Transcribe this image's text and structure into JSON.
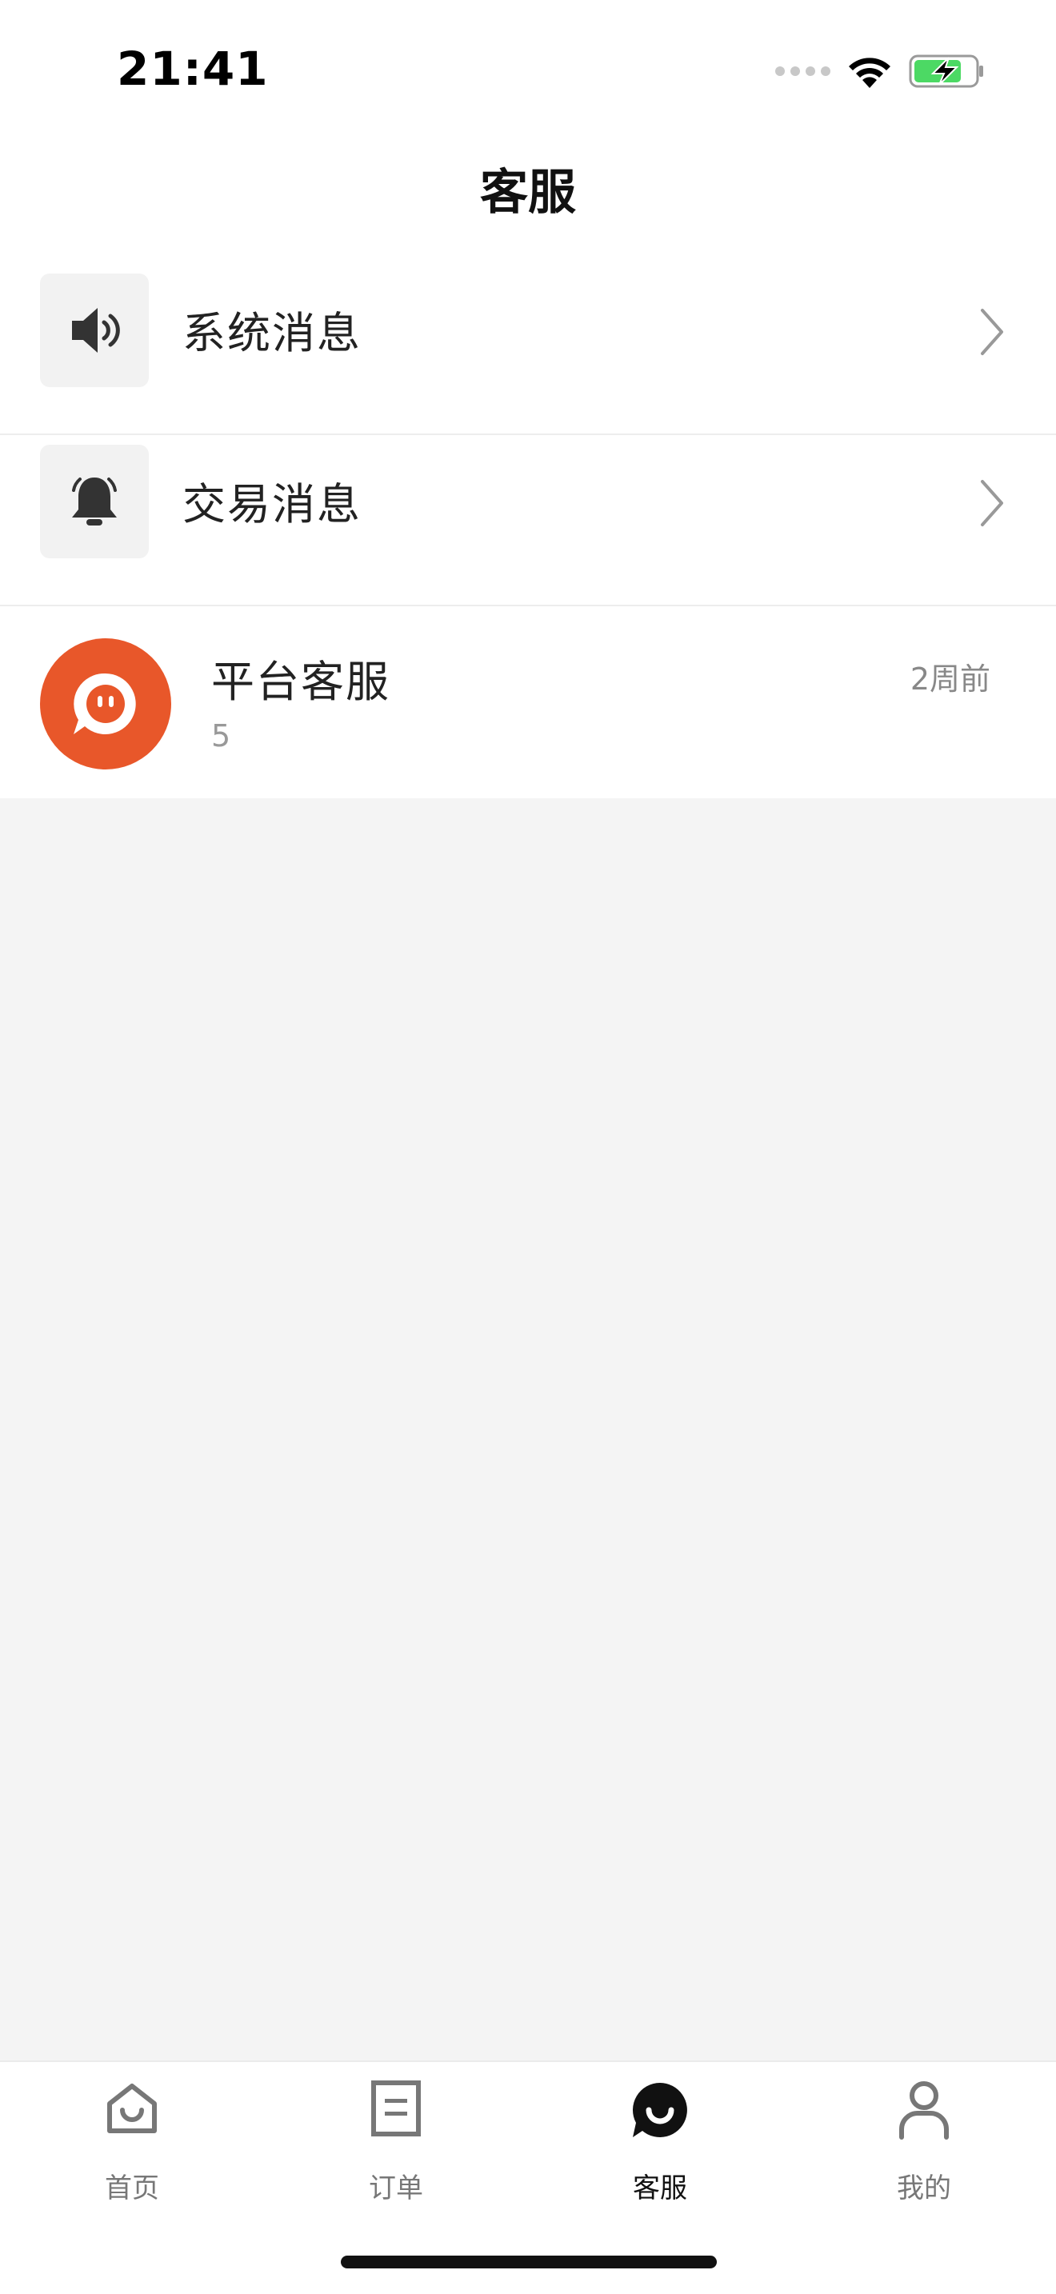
{
  "status_bar": {
    "time": "21:41"
  },
  "nav": {
    "title": "客服"
  },
  "list": {
    "items": [
      {
        "label": "系统消息",
        "icon": "speaker-icon"
      },
      {
        "label": "交易消息",
        "icon": "bell-icon"
      }
    ],
    "chat": {
      "name": "平台客服",
      "time": "2周前",
      "preview": "5",
      "avatar_color": "#e8572a"
    }
  },
  "tabbar": {
    "tabs": [
      {
        "label": "首页",
        "icon": "home-icon"
      },
      {
        "label": "订单",
        "icon": "order-icon"
      },
      {
        "label": "客服",
        "icon": "customer-service-icon",
        "active": true
      },
      {
        "label": "我的",
        "icon": "profile-icon"
      }
    ]
  },
  "colors": {
    "accent": "#e8572a",
    "battery_green": "#4cd964",
    "background": "#f4f4f4"
  }
}
